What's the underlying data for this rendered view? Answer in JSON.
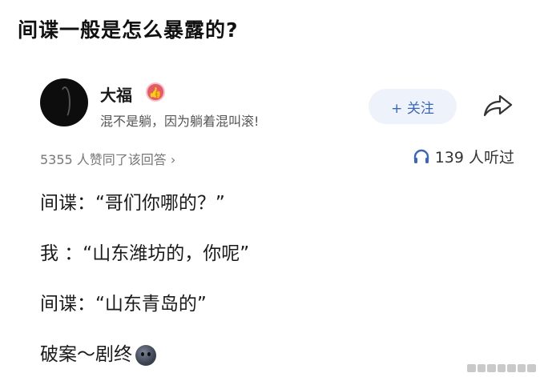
{
  "title": "间谍一般是怎么暴露的?",
  "author": {
    "name": "大福",
    "badge_icon": "thumbs-up-badge-icon",
    "bio": "混不是躺，因为躺着混叫滚!"
  },
  "actions": {
    "follow_label": "+ 关注",
    "share_icon": "share-arrow-icon"
  },
  "meta": {
    "likes_text": "5355 人赞同了该回答 ›",
    "listen_icon": "headphone-icon",
    "listen_text": "139 人听过"
  },
  "content": {
    "lines": [
      "间谍：“哥们你哪的？”",
      "我 ：“山东潍坊的，你呢”",
      "间谍：“山东青岛的”",
      "破案～剧终"
    ],
    "emoji_icon": "moon-face-emoji-icon"
  },
  "colors": {
    "accent": "#3b68b6",
    "follow_bg": "#eef3fb",
    "badge": "#e35b68"
  }
}
